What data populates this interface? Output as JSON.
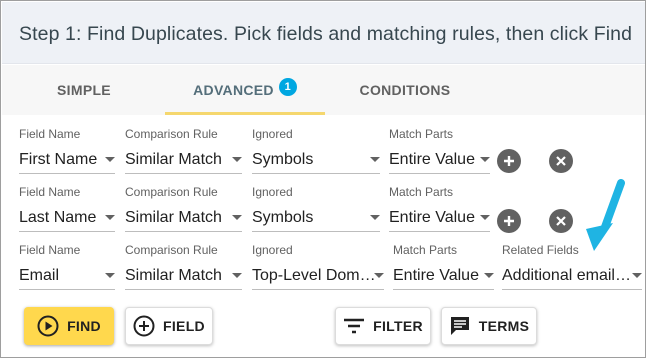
{
  "header": {
    "title": "Step 1: Find Duplicates. Pick fields and matching rules, then click Find"
  },
  "tabs": [
    {
      "label": "SIMPLE"
    },
    {
      "label": "ADVANCED",
      "badge": "1"
    },
    {
      "label": "CONDITIONS"
    }
  ],
  "rows": [
    {
      "field_label": "Field Name",
      "field_value": "First Name",
      "rule_label": "Comparison Rule",
      "rule_value": "Similar Match",
      "ignored_label": "Ignored",
      "ignored_value": "Symbols",
      "parts_label": "Match Parts",
      "parts_value": "Entire Value"
    },
    {
      "field_label": "Field Name",
      "field_value": "Last Name",
      "rule_label": "Comparison Rule",
      "rule_value": "Similar Match",
      "ignored_label": "Ignored",
      "ignored_value": "Symbols",
      "parts_label": "Match Parts",
      "parts_value": "Entire Value"
    },
    {
      "field_label": "Field Name",
      "field_value": "Email",
      "rule_label": "Comparison Rule",
      "rule_value": "Similar Match",
      "ignored_label": "Ignored",
      "ignored_value": "Top-Level Dom…",
      "parts_label": "Match Parts",
      "parts_value": "Entire Value",
      "related_label": "Related Fields",
      "related_value": "Additional email…"
    }
  ],
  "buttons": {
    "find": "FIND",
    "field": "FIELD",
    "filter": "FILTER",
    "terms": "TERMS"
  },
  "colors": {
    "accent_yellow": "#ffd84d",
    "badge_blue": "#00a7e1",
    "arrow_blue": "#1fb4e3",
    "header_bg": "#eef1f6"
  },
  "icons": {
    "add_row": "plus-circle-icon",
    "remove_row": "close-circle-icon",
    "find": "play-circle-icon",
    "field": "plus-circle-outline-icon",
    "filter": "filter-lines-icon",
    "terms": "comment-icon",
    "annotation": "arrow-icon"
  }
}
